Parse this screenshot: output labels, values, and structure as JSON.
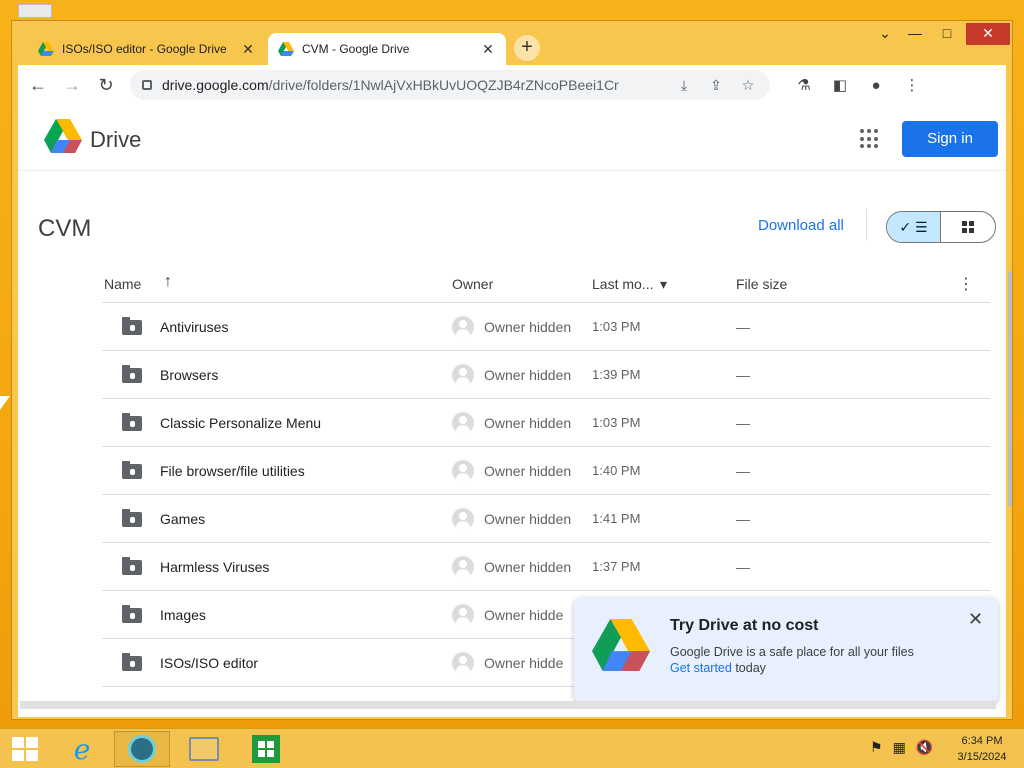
{
  "browser": {
    "tabs": [
      {
        "title": "ISOs/ISO editor - Google Drive",
        "active": false
      },
      {
        "title": "CVM - Google Drive",
        "active": true
      }
    ],
    "url_host": "drive.google.com",
    "url_path": "/drive/folders/1NwlAjVxHBkUvUOQZJB4rZNcoPBeei1Cr",
    "window_controls": {
      "minimize": "▭",
      "maximize": "□",
      "close": "✕",
      "tab_search": "⌄"
    }
  },
  "drive": {
    "brand": "Drive",
    "sign_in": "Sign in",
    "folder_title": "CVM",
    "download_all": "Download all",
    "view_check": "✓",
    "columns": {
      "name": "Name",
      "sort_arrow": "↑",
      "owner": "Owner",
      "modified": "Last mo...",
      "modified_arrow": "▾",
      "size": "File size",
      "more": "⋮"
    },
    "rows": [
      {
        "name": "Antiviruses",
        "owner": "Owner hidden",
        "modified": "1:03 PM",
        "size": "—"
      },
      {
        "name": "Browsers",
        "owner": "Owner hidden",
        "modified": "1:39 PM",
        "size": "—"
      },
      {
        "name": "Classic Personalize Menu",
        "owner": "Owner hidden",
        "modified": "1:03 PM",
        "size": "—"
      },
      {
        "name": "File browser/file utilities",
        "owner": "Owner hidden",
        "modified": "1:40 PM",
        "size": "—"
      },
      {
        "name": "Games",
        "owner": "Owner hidden",
        "modified": "1:41 PM",
        "size": "—"
      },
      {
        "name": "Harmless Viruses",
        "owner": "Owner hidden",
        "modified": "1:37 PM",
        "size": "—"
      },
      {
        "name": "Images",
        "owner": "Owner hidde",
        "modified": "",
        "size": ""
      },
      {
        "name": "ISOs/ISO editor",
        "owner": "Owner hidde",
        "modified": "",
        "size": ""
      }
    ],
    "promo": {
      "title": "Try Drive at no cost",
      "text": "Google Drive is a safe place for all your files",
      "link": "Get started",
      "after_link": " today",
      "close": "✕"
    }
  },
  "taskbar": {
    "time": "6:34 PM",
    "date": "3/15/2024",
    "ie_glyph": "e"
  },
  "colors": {
    "accent": "#1a73e8",
    "desktop": "#f4a70f"
  }
}
